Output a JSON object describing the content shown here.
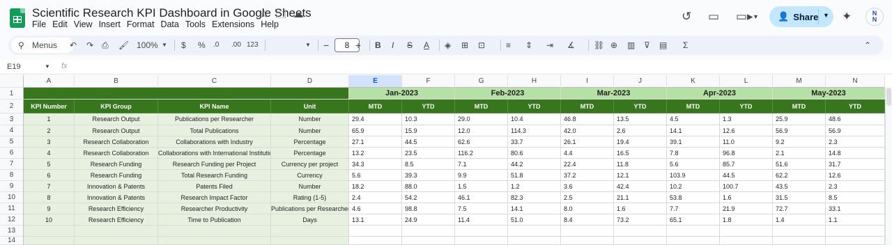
{
  "app": {
    "title": "Scientific Research KPI Dashboard in Google Sheets",
    "menu": [
      "File",
      "Edit",
      "View",
      "Insert",
      "Format",
      "Data",
      "Tools",
      "Extensions",
      "Help"
    ],
    "share_label": "Share",
    "avatar_text": "N\nN"
  },
  "toolbar": {
    "menus_label": "Menus",
    "zoom": "100%",
    "currency": "$",
    "percent": "%",
    "dec_decrease": ".0",
    "dec_increase": ".00",
    "format_123": "123",
    "font_size": "8"
  },
  "formula": {
    "cell_ref": "E19",
    "fx": "fx"
  },
  "columns": [
    "A",
    "B",
    "C",
    "D",
    "E",
    "F",
    "G",
    "H",
    "I",
    "J",
    "K",
    "L",
    "M",
    "N"
  ],
  "selected_column": "E",
  "rows": [
    "1",
    "2",
    "3",
    "4",
    "5",
    "6",
    "7",
    "8",
    "9",
    "10",
    "11",
    "12",
    "13",
    "14"
  ],
  "months": [
    "Jan-2023",
    "Feb-2023",
    "Mar-2023",
    "Apr-2023",
    "May-2023"
  ],
  "headers": {
    "kpi_number": "KPI Number",
    "kpi_group": "KPI Group",
    "kpi_name": "KPI Name",
    "unit": "Unit",
    "mtd": "MTD",
    "ytd": "YTD"
  },
  "kpis": [
    {
      "num": "1",
      "group": "Research Output",
      "name": "Publications per Researcher",
      "unit": "Number",
      "vals": [
        "29.4",
        "10.3",
        "29.0",
        "10.4",
        "46.8",
        "13.5",
        "4.5",
        "1.3",
        "25.9",
        "48.6"
      ]
    },
    {
      "num": "2",
      "group": "Research Output",
      "name": "Total Publications",
      "unit": "Number",
      "vals": [
        "65.9",
        "15.9",
        "12.0",
        "114.3",
        "42.0",
        "2.6",
        "14.1",
        "12.6",
        "56.9",
        "56.9"
      ]
    },
    {
      "num": "3",
      "group": "Research Collaboration",
      "name": "Collaborations with Industry",
      "unit": "Percentage",
      "vals": [
        "27.1",
        "44.5",
        "62.6",
        "33.7",
        "26.1",
        "19.4",
        "39.1",
        "11.0",
        "9.2",
        "2.3"
      ]
    },
    {
      "num": "4",
      "group": "Research Collaboration",
      "name": "Collaborations with International Institutions",
      "unit": "Percentage",
      "vals": [
        "13.2",
        "23.5",
        "116.2",
        "80.6",
        "4.4",
        "16.5",
        "7.8",
        "96.8",
        "2.1",
        "14.8"
      ]
    },
    {
      "num": "5",
      "group": "Research Funding",
      "name": "Research Funding per Project",
      "unit": "Currency per project",
      "vals": [
        "34.3",
        "8.5",
        "7.1",
        "44.2",
        "22.4",
        "11.8",
        "5.6",
        "85.7",
        "51.6",
        "31.7"
      ]
    },
    {
      "num": "6",
      "group": "Research Funding",
      "name": "Total Research Funding",
      "unit": "Currency",
      "vals": [
        "5.6",
        "39.3",
        "9.9",
        "51.8",
        "37.2",
        "12.1",
        "103.9",
        "44.5",
        "62.2",
        "12.6"
      ]
    },
    {
      "num": "7",
      "group": "Innovation & Patents",
      "name": "Patents Filed",
      "unit": "Number",
      "vals": [
        "18.2",
        "88.0",
        "1.5",
        "1.2",
        "3.6",
        "42.4",
        "10.2",
        "100.7",
        "43.5",
        "2.3"
      ]
    },
    {
      "num": "8",
      "group": "Innovation & Patents",
      "name": "Research Impact Factor",
      "unit": "Rating (1-5)",
      "vals": [
        "2.4",
        "54.2",
        "46.1",
        "82.3",
        "2.5",
        "21.1",
        "53.8",
        "1.6",
        "31.5",
        "8.5"
      ]
    },
    {
      "num": "9",
      "group": "Research Efficiency",
      "name": "Researcher Productivity",
      "unit": "Publications per Researcher",
      "vals": [
        "4.6",
        "98.8",
        "7.5",
        "14.1",
        "8.0",
        "1.6",
        "7.7",
        "21.9",
        "72.7",
        "33.1"
      ]
    },
    {
      "num": "10",
      "group": "Research Efficiency",
      "name": "Time to Publication",
      "unit": "Days",
      "vals": [
        "13.1",
        "24.9",
        "11.4",
        "51.0",
        "8.4",
        "73.2",
        "65.1",
        "1.8",
        "1.4",
        "1.1"
      ]
    }
  ]
}
